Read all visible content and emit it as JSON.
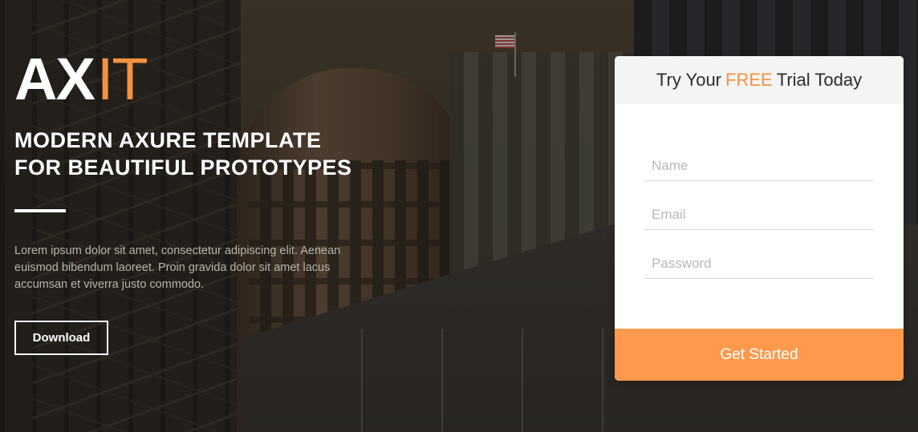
{
  "hero": {
    "logo_main": "AX",
    "logo_accent": "IT",
    "headline_line1": "MODERN AXURE TEMPLATE",
    "headline_line2": "FOR BEAUTIFUL PROTOTYPES",
    "body": "Lorem ipsum dolor sit amet, consectetur adipiscing elit. Aenean euismod bibendum laoreet. Proin gravida dolor sit amet lacus accumsan et viverra justo commodo.",
    "download_label": "Download"
  },
  "signup": {
    "title_before": "Try Your",
    "title_highlight": "FREE",
    "title_after": "Trial Today",
    "name_placeholder": "Name",
    "email_placeholder": "Email",
    "password_placeholder": "Password",
    "submit_label": "Get Started"
  },
  "colors": {
    "accent": "#f5923e",
    "button": "#ff9a4d",
    "header_bg": "#f4f4f4"
  }
}
